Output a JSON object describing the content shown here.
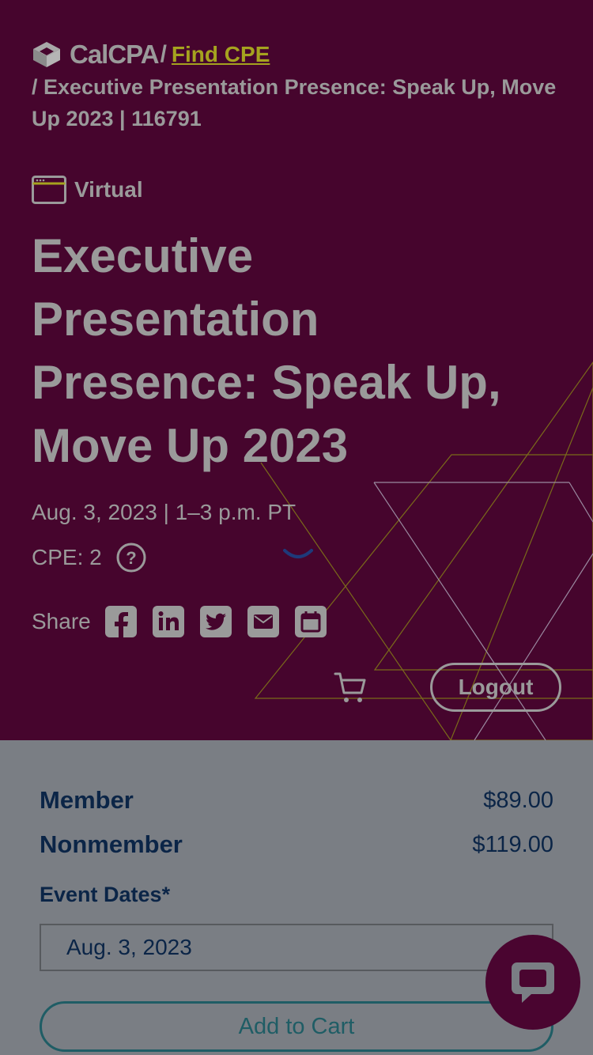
{
  "breadcrumb": {
    "logo_text": "CalCPA",
    "separator": "/",
    "link_label": "Find CPE",
    "current": "/ Executive Presentation Presence: Speak Up, Move Up 2023 | 116791"
  },
  "event": {
    "format": "Virtual",
    "title": "Executive Presentation Presence: Speak Up, Move Up 2023",
    "date_time": "Aug. 3, 2023 | 1–3 p.m. PT",
    "cpe": "CPE: 2"
  },
  "share": {
    "label": "Share",
    "icons": [
      "facebook-icon",
      "linkedin-icon",
      "twitter-icon",
      "email-icon",
      "calendar-icon"
    ]
  },
  "header": {
    "cart_icon": "cart-icon",
    "logout_label": "Logout"
  },
  "pricing": {
    "rows": [
      {
        "label": "Member",
        "price": "$89.00"
      },
      {
        "label": "Nonmember",
        "price": "$119.00"
      }
    ]
  },
  "event_dates": {
    "label": "Event Dates*",
    "selected": "Aug. 3, 2023"
  },
  "actions": {
    "add_to_cart": "Add to Cart"
  },
  "chat": {
    "icon": "chat-bubble-icon"
  },
  "colors": {
    "hero_bg": "#46052d",
    "overlay_text": "#9a9a9a",
    "link": "#a5a31f",
    "navy": "#0b2547",
    "teal": "#1f5d65",
    "chat_bg": "#4a0530"
  }
}
